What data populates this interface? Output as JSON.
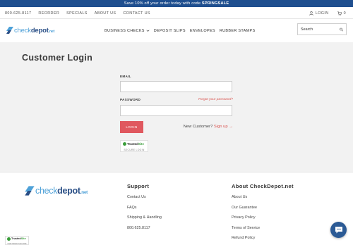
{
  "promo": {
    "text_before": "Save 10% off your order today with code ",
    "code": "SPRINGSALE"
  },
  "topbar": {
    "links": [
      "800.625.8117",
      "REORDER",
      "SPECIALS",
      "ABOUT US",
      "CONTACT US"
    ],
    "login_label": "LOGIN",
    "cart_count": "0"
  },
  "header": {
    "logo": {
      "part1": "check",
      "part2": "depot",
      "part3": ".net"
    },
    "nav": [
      "BUSINESS CHECKS",
      "DEPOSIT SLIPS",
      "ENVELOPES",
      "RUBBER STAMPS"
    ],
    "search_placeholder": "Search"
  },
  "login": {
    "title": "Customer Login",
    "email_label": "EMAIL",
    "password_label": "PASSWORD",
    "forgot": "Forgot your password?",
    "button": "LOGIN",
    "new_customer": "New Customer?",
    "signup": "Sign up →"
  },
  "trust_badge": {
    "name_a": "Trusted",
    "name_b": "Site",
    "sub": "SECURE LOGIN"
  },
  "trust_badge_small": {
    "name_a": "Trusted",
    "name_b": "Site",
    "sub": "CERTIFIED SECURE"
  },
  "footer": {
    "logo": {
      "part1": "check",
      "part2": "depot",
      "part3": ".net"
    },
    "support": {
      "heading": "Support",
      "links": [
        "Contact Us",
        "FAQs",
        "Shipping & Handling",
        "800.625.8117"
      ]
    },
    "about": {
      "heading": "About CheckDepot.net",
      "links": [
        "About Us",
        "Our Guarantee",
        "Privacy Policy",
        "Terms of Service",
        "Refund Policy"
      ]
    }
  },
  "colors": {
    "promo_bg": "#1f4f8f",
    "accent_red": "#e0585f",
    "brand_blue": "#2a4f86",
    "brand_light_blue": "#4ea1d8",
    "main_bg": "#f2f2f2"
  },
  "icons": [
    "user-icon",
    "cart-icon",
    "search-icon",
    "chevron-down-icon",
    "chat-icon",
    "check-icon"
  ]
}
